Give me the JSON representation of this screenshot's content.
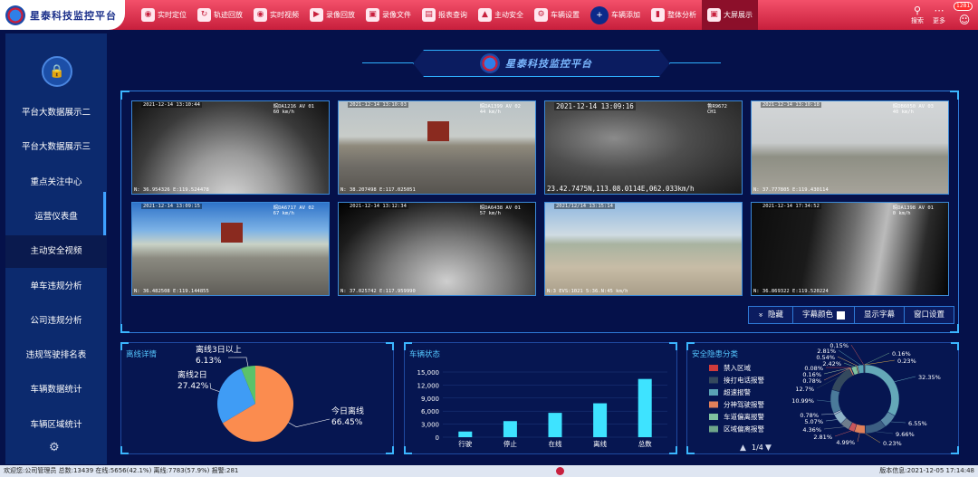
{
  "app": {
    "title": "星泰科技监控平台"
  },
  "nav": [
    {
      "label": "实时定位",
      "icon": "map-pin-icon"
    },
    {
      "label": "轨迹回放",
      "icon": "track-icon"
    },
    {
      "label": "实时视频",
      "icon": "video-icon"
    },
    {
      "label": "录像回放",
      "icon": "replay-icon"
    },
    {
      "label": "录像文件",
      "icon": "clapper-icon"
    },
    {
      "label": "报表查询",
      "icon": "report-icon"
    },
    {
      "label": "主动安全",
      "icon": "shield-icon"
    },
    {
      "label": "车辆设置",
      "icon": "gear-icon"
    },
    {
      "label": "车辆添加",
      "icon": "add-vehicle-icon"
    },
    {
      "label": "整体分析",
      "icon": "bar-chart-icon"
    },
    {
      "label": "大屏展示",
      "icon": "monitor-icon"
    }
  ],
  "topright": {
    "search": "搜索",
    "more": "更多",
    "badge": "1281"
  },
  "sidebar": [
    {
      "label": "平台大数据展示二"
    },
    {
      "label": "平台大数据展示三"
    },
    {
      "label": "重点关注中心"
    },
    {
      "label": "运营仪表盘"
    },
    {
      "label": "主动安全视频"
    },
    {
      "label": "单车违规分析"
    },
    {
      "label": "公司违规分析"
    },
    {
      "label": "违规驾驶排名表"
    },
    {
      "label": "车辆数据统计"
    },
    {
      "label": "车辆区域统计"
    }
  ],
  "panel_header": {
    "title": "星泰科技监控平台"
  },
  "cameras": [
    {
      "ts": "2021-12-14 13:10:44",
      "plate": "皖DA1216 AV 01",
      "speed": "60 km/h",
      "gps": "N: 36.954326 E:119.524478",
      "style": "cab"
    },
    {
      "ts": "2021-12-14 13:10:03",
      "plate": "皖DA1399 AV 02",
      "speed": "44 km/h",
      "gps": "N: 38.207498 E:117.025051",
      "style": "road"
    },
    {
      "ts": "2021-12-14 13:09:16",
      "plate": "鲁R9672",
      "speed": "CH1",
      "gps": "23.42.7475N,113.08.0114E,062.033km/h",
      "style": "dark"
    },
    {
      "ts": "2021-12-14 13:10:18",
      "plate": "皖DB6050 AV 03",
      "speed": "40 km/h",
      "gps": "N: 37.777805 E:119.430114",
      "style": "fog"
    },
    {
      "ts": "2021-12-14 13:09:15",
      "plate": "皖DA6717 AV 02",
      "speed": "67 km/h",
      "gps": "N: 36.482508 E:119.144855",
      "style": "road2"
    },
    {
      "ts": "2021-12-14 13:12:34",
      "plate": "皖DA6438 AV 01",
      "speed": "57 km/h",
      "gps": "N: 37.025742 E:117.959990",
      "style": "cab2"
    },
    {
      "ts": "2021/12/14 13:15:14",
      "plate": "",
      "speed": "",
      "gps": "N:3 EVS:1021 5:36.N:45 km/h",
      "style": "village"
    },
    {
      "ts": "2021-12-14 17:34:52",
      "plate": "皖DA1398 AV 01",
      "speed": "0 km/h",
      "gps": "N: 36.869322 E:119.520224",
      "style": "cab3"
    }
  ],
  "controls": [
    {
      "label": "隐藏",
      "icon": "chevron-double-down-icon"
    },
    {
      "label": "字幕颜色"
    },
    {
      "label": "显示字幕"
    },
    {
      "label": "窗口设置"
    }
  ],
  "offline": {
    "title": "离线详情",
    "slices": [
      {
        "label": "今日离线",
        "pct": "66.45%",
        "value": 66.45,
        "color": "#fb8c4f"
      },
      {
        "label": "离线2日",
        "pct": "27.42%",
        "value": 27.42,
        "color": "#3f9cf5"
      },
      {
        "label": "离线3日以上",
        "pct": "6.13%",
        "value": 6.13,
        "color": "#5cc26a"
      }
    ]
  },
  "vehicle": {
    "title": "车辆状态",
    "chart_data": {
      "type": "bar",
      "categories": [
        "行驶",
        "停止",
        "在线",
        "离线",
        "总数"
      ],
      "values": [
        1300,
        3700,
        5600,
        7800,
        13400
      ],
      "ylim": [
        0,
        15000
      ],
      "yticks": [
        "0",
        "3,000",
        "6,000",
        "9,000",
        "12,000",
        "15,000"
      ],
      "color": "#3ee3ff"
    }
  },
  "safety": {
    "title": "安全隐患分类",
    "legend": [
      {
        "label": "禁入区域",
        "color": "#cf3b3b"
      },
      {
        "label": "接打电话报警",
        "color": "#34495e"
      },
      {
        "label": "超速报警",
        "color": "#5aa3b5"
      },
      {
        "label": "分神驾驶报警",
        "color": "#e0805a"
      },
      {
        "label": "车道偏离报警",
        "color": "#7fc19f"
      },
      {
        "label": "区域偏离报警",
        "color": "#6fa68a"
      }
    ],
    "page": "1/4",
    "donut": [
      {
        "pct": "32.35%",
        "value": 32.35,
        "color": "#64a8b8"
      },
      {
        "pct": "6.55%",
        "value": 6.55,
        "color": "#5a8aa6"
      },
      {
        "pct": "9.66%",
        "value": 9.66,
        "color": "#3c5e82"
      },
      {
        "pct": "0.23%",
        "value": 0.23,
        "color": "#d7a64b"
      },
      {
        "pct": "4.99%",
        "value": 4.99,
        "color": "#e0805a"
      },
      {
        "pct": "2.81%",
        "value": 2.81,
        "color": "#c9565b"
      },
      {
        "pct": "4.36%",
        "value": 4.36,
        "color": "#6f7d8c"
      },
      {
        "pct": "5.07%",
        "value": 5.07,
        "color": "#8fb3c7"
      },
      {
        "pct": "0.78%",
        "value": 0.78,
        "color": "#b6cad8"
      },
      {
        "pct": "10.99%",
        "value": 10.99,
        "color": "#4a7a9a"
      },
      {
        "pct": "12.7%",
        "value": 12.7,
        "color": "#34495e"
      },
      {
        "pct": "0.78%",
        "value": 0.78,
        "color": "#d98c67"
      },
      {
        "pct": "0.16%",
        "value": 0.16,
        "color": "#a3c4a3"
      },
      {
        "pct": "0.08%",
        "value": 0.08,
        "color": "#cf3b3b"
      },
      {
        "pct": "2.42%",
        "value": 2.42,
        "color": "#7fc19f"
      },
      {
        "pct": "0.54%",
        "value": 0.54,
        "color": "#e8b96a"
      },
      {
        "pct": "2.81%",
        "value": 2.81,
        "color": "#5aa3b5"
      },
      {
        "pct": "0.15%",
        "value": 0.15,
        "color": "#c9565b"
      },
      {
        "pct": "0.16%",
        "value": 0.16,
        "color": "#6fa68a"
      },
      {
        "pct": "0.23%",
        "value": 0.23,
        "color": "#d7a64b"
      }
    ]
  },
  "status": {
    "left": "欢迎您:公司管理员   总数:13439   在线:5656(42.1%)   离线:7783(57.9%)   报警:281",
    "right": "版本信息:2021-12-05 17:14:48"
  }
}
